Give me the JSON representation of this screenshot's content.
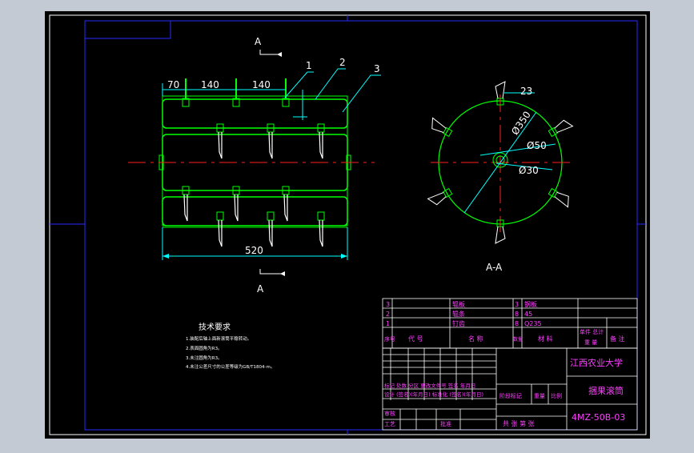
{
  "colors": {
    "background": "#c3cad3",
    "paper": "#000000",
    "frame": "#ffffff",
    "border": "#2020ff",
    "outline": "#00ff00",
    "dimension": "#00ffff",
    "centerline": "#ff2020",
    "tine": "#ffffff",
    "table_text": "#ff40ff",
    "title_text": "#ff40ff"
  },
  "views": {
    "section_mark_top": "A",
    "section_mark_bottom": "A",
    "section_label": "A-A"
  },
  "dimensions": {
    "d70": "70",
    "d140a": "140",
    "d140b": "140",
    "d520": "520",
    "d23": "23",
    "dia350": "Ø350",
    "dia50": "Ø50",
    "dia30": "Ø30"
  },
  "balloons": [
    "1",
    "2",
    "3"
  ],
  "tech": {
    "title": "技术要求",
    "lines": [
      "1.装配后轴上面新滚筒平稳转动。",
      "2.表面圆角为R3。",
      "3.未注圆角为R3。",
      "4.未注公差尺寸的公差等级为GB/T1804-m。"
    ]
  },
  "bom": [
    {
      "no": "3",
      "name": "辊板",
      "qty": "3",
      "material": "钢板"
    },
    {
      "no": "2",
      "name": "辊条",
      "qty": "8",
      "material": "45"
    },
    {
      "no": "1",
      "name": "钉齿",
      "qty": "8",
      "material": "Q235"
    }
  ],
  "bom_header": {
    "no": "序号",
    "code": "代 号",
    "name": "名 称",
    "qty": "数量",
    "material": "材 料",
    "weight": "单件 总计",
    "weight2": "重 量",
    "remark": "备 注"
  },
  "title_block": {
    "school": "江西农业大学",
    "part_name": "捆果滚筒",
    "drawing_no": "4MZ-50B-03",
    "row_mark": "标记 处数 分区 更改文件号 签名 年月日",
    "row_design": "设计 (签名)(年月日) 标准化 (签名)(年月日)",
    "stage": "阶段标记",
    "weight": "重量",
    "scale": "比例",
    "check": "审核",
    "process": "工艺",
    "approve": "批准",
    "sheets": "共 张 第 张"
  }
}
